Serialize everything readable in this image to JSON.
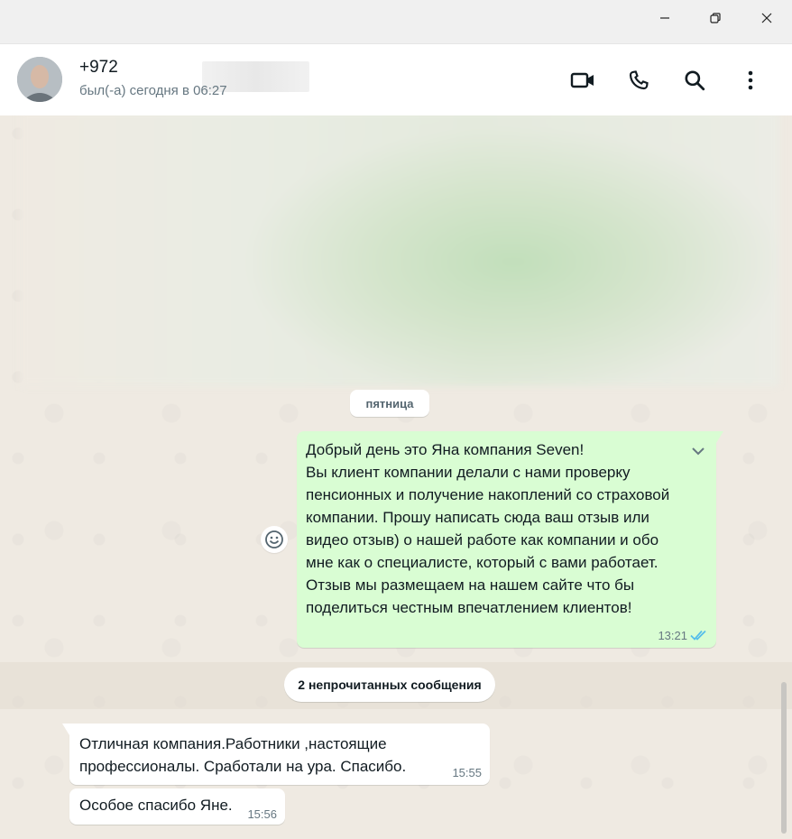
{
  "window": {
    "minimize_icon": "minimize-icon",
    "restore_icon": "restore-icon",
    "close_icon": "close-icon"
  },
  "header": {
    "contact_name": "+972",
    "status": "был(-а) сегодня в 06:27",
    "icons": [
      "video-call-icon",
      "voice-call-icon",
      "search-icon",
      "more-vert-icon"
    ]
  },
  "chat": {
    "date_label": "пятница",
    "outgoing_message": {
      "text": "Добрый день это Яна компания Seven!\nВы клиент компании делали с нами проверку пенсионных и получение накоплений со страховой компании. Прошу написать сюда ваш отзыв или видео отзыв) о нашей работе как компании и обо мне как о специалисте, который  с вами работает. Отзыв мы размещаем на нашем сайте что бы поделиться честным впечатлением клиентов!",
      "time": "13:21",
      "status_icon": "double-check-icon"
    },
    "unread_label": "2 непрочитанных сообщения",
    "incoming_messages": [
      {
        "text": "Отличная компания.Работники ,настоящие профессионалы. Сработали на ура. Спасибо.",
        "time": "15:55"
      },
      {
        "text": "Особое спасибо Яне.",
        "time": "15:56"
      }
    ]
  },
  "colors": {
    "outgoing_bubble": "#d9fdd3",
    "incoming_bubble": "#ffffff",
    "chat_background": "#efeae2",
    "read_ticks": "#53bdeb"
  }
}
